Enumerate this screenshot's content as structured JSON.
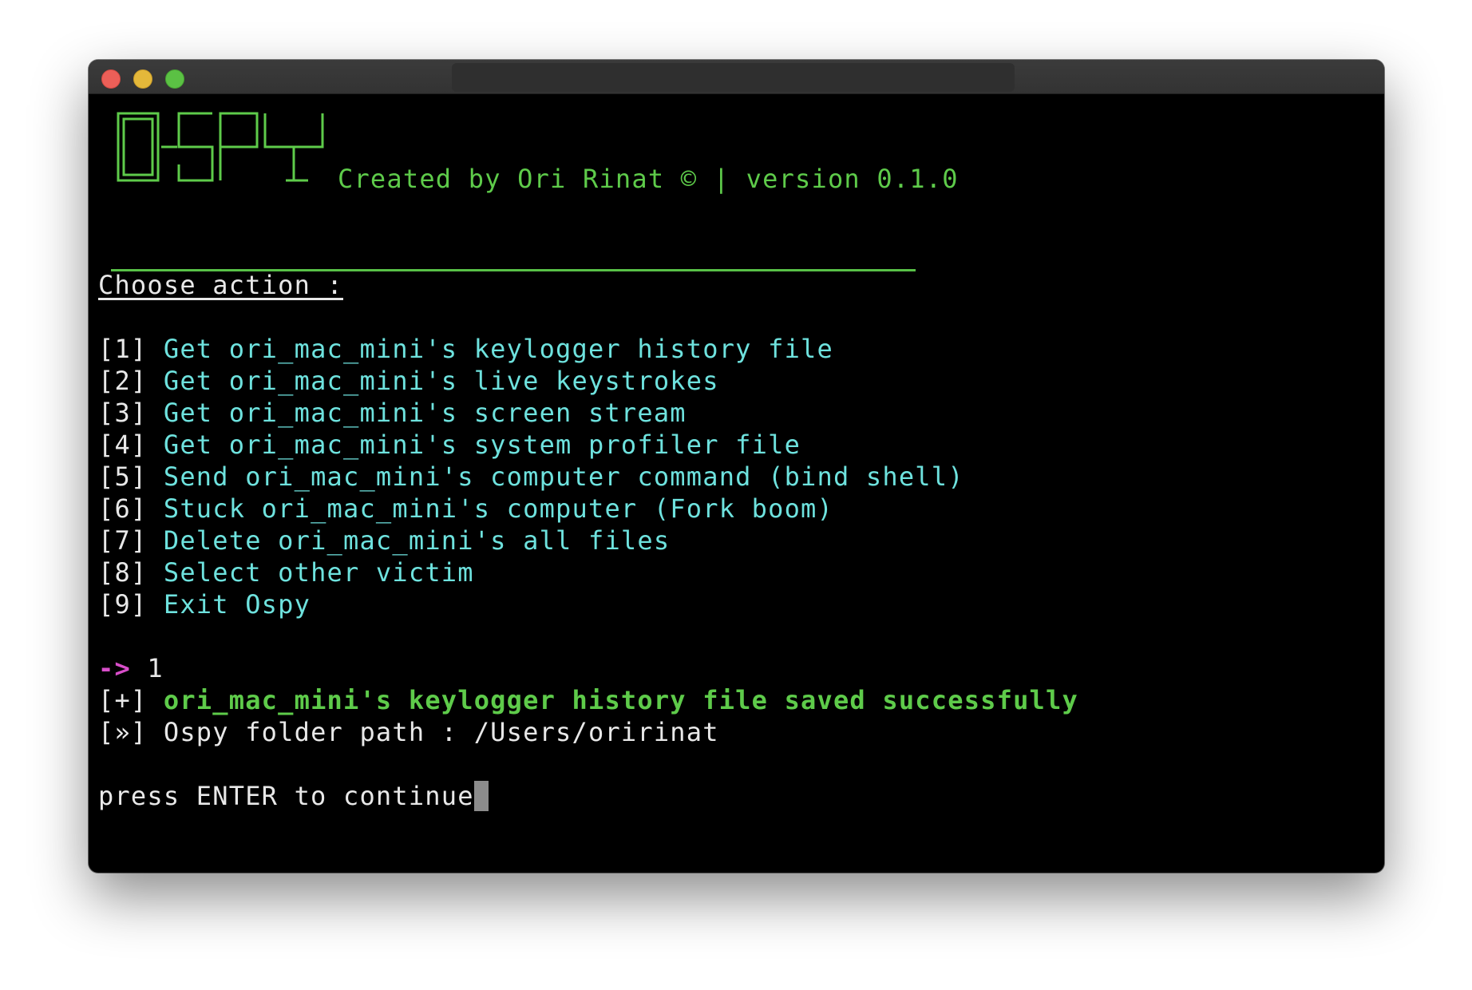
{
  "window": {
    "title": "",
    "buttons": [
      "close",
      "minimize",
      "zoom"
    ]
  },
  "header": {
    "logo_text": "O-SPY",
    "credit": "Created by Ori Rinat © | version 0.1.0"
  },
  "menu": {
    "heading": "Choose action :",
    "items": [
      {
        "key": "[1]",
        "label": "Get ori_mac_mini's keylogger history file"
      },
      {
        "key": "[2]",
        "label": "Get ori_mac_mini's live keystrokes"
      },
      {
        "key": "[3]",
        "label": "Get ori_mac_mini's screen stream"
      },
      {
        "key": "[4]",
        "label": "Get ori_mac_mini's system profiler file"
      },
      {
        "key": "[5]",
        "label": "Send ori_mac_mini's computer command (bind shell)"
      },
      {
        "key": "[6]",
        "label": "Stuck ori_mac_mini's computer (Fork boom)"
      },
      {
        "key": "[7]",
        "label": "Delete ori_mac_mini's all files"
      },
      {
        "key": "[8]",
        "label": "Select other victim"
      },
      {
        "key": "[9]",
        "label": "Exit Ospy"
      }
    ]
  },
  "session": {
    "prompt": "->",
    "input": " 1",
    "success_prefix": "[+]",
    "success_text": "ori_mac_mini's keylogger history file saved successfully",
    "path_prefix": "[»]",
    "path_text": "Ospy folder path : /Users/oririnat",
    "continue_text": "press ENTER to continue"
  },
  "colors": {
    "background": "#000000",
    "text": "#e8e8e8",
    "menu_text": "#6ee2de",
    "success": "#5ecb4a",
    "prompt": "#d84ec9"
  }
}
